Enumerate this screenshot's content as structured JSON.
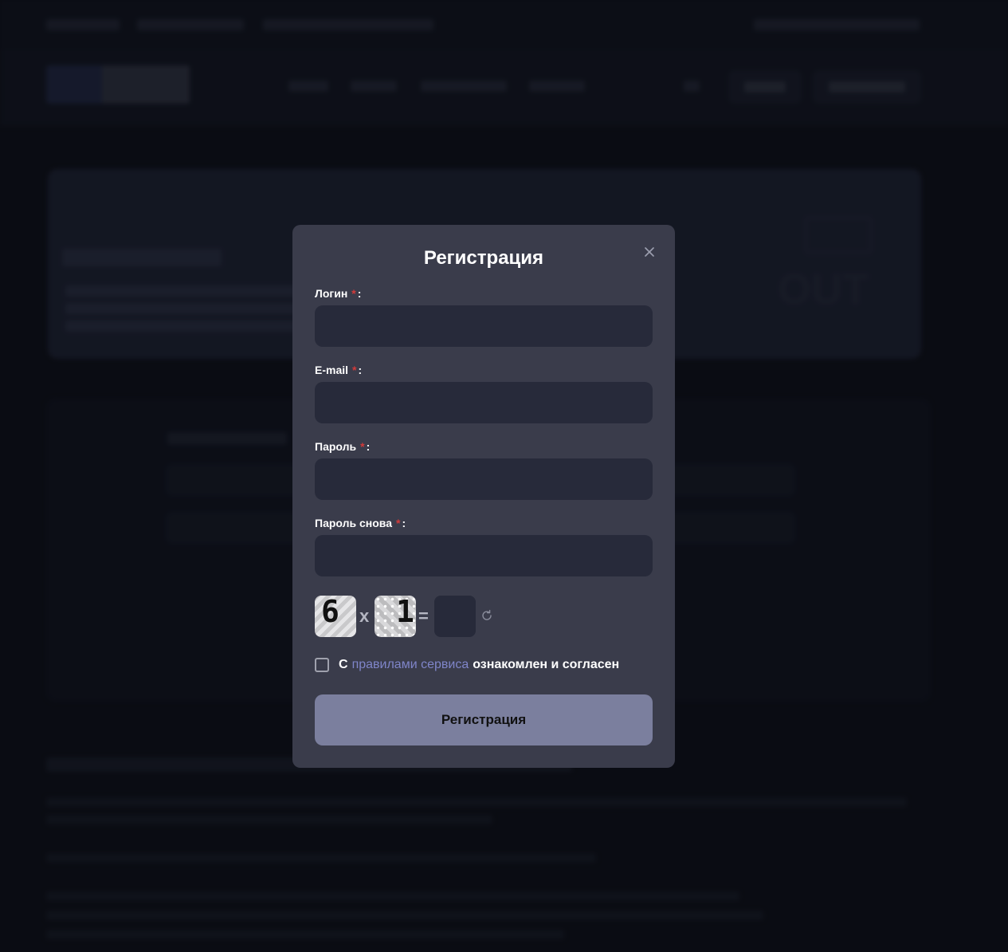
{
  "modal": {
    "title": "Регистрация",
    "fields": [
      {
        "label": "Логин",
        "required_mark": "*",
        "suffix": ":",
        "value": ""
      },
      {
        "label": "E-mail",
        "required_mark": "*",
        "suffix": ":",
        "value": ""
      },
      {
        "label": "Пароль",
        "required_mark": "*",
        "suffix": ":",
        "value": ""
      },
      {
        "label": "Пароль снова",
        "required_mark": "*",
        "suffix": ":",
        "value": ""
      }
    ],
    "captcha": {
      "operand_a": "6",
      "operator": "x",
      "operand_b": "1",
      "equals": "=",
      "answer": ""
    },
    "agreement": {
      "prefix": "С",
      "link_text": "правилами сервиса",
      "suffix": "ознакомлен и согласен",
      "checked": false
    },
    "submit_label": "Регистрация"
  },
  "icons": {
    "close": "close-icon",
    "refresh": "refresh-icon",
    "checkbox": "checkbox-unchecked"
  },
  "colors": {
    "modal_bg": "#3a3c4b",
    "input_bg": "#272a3a",
    "link": "#7f85c9",
    "button": "#7b7f9e",
    "required": "#d23a3a"
  }
}
